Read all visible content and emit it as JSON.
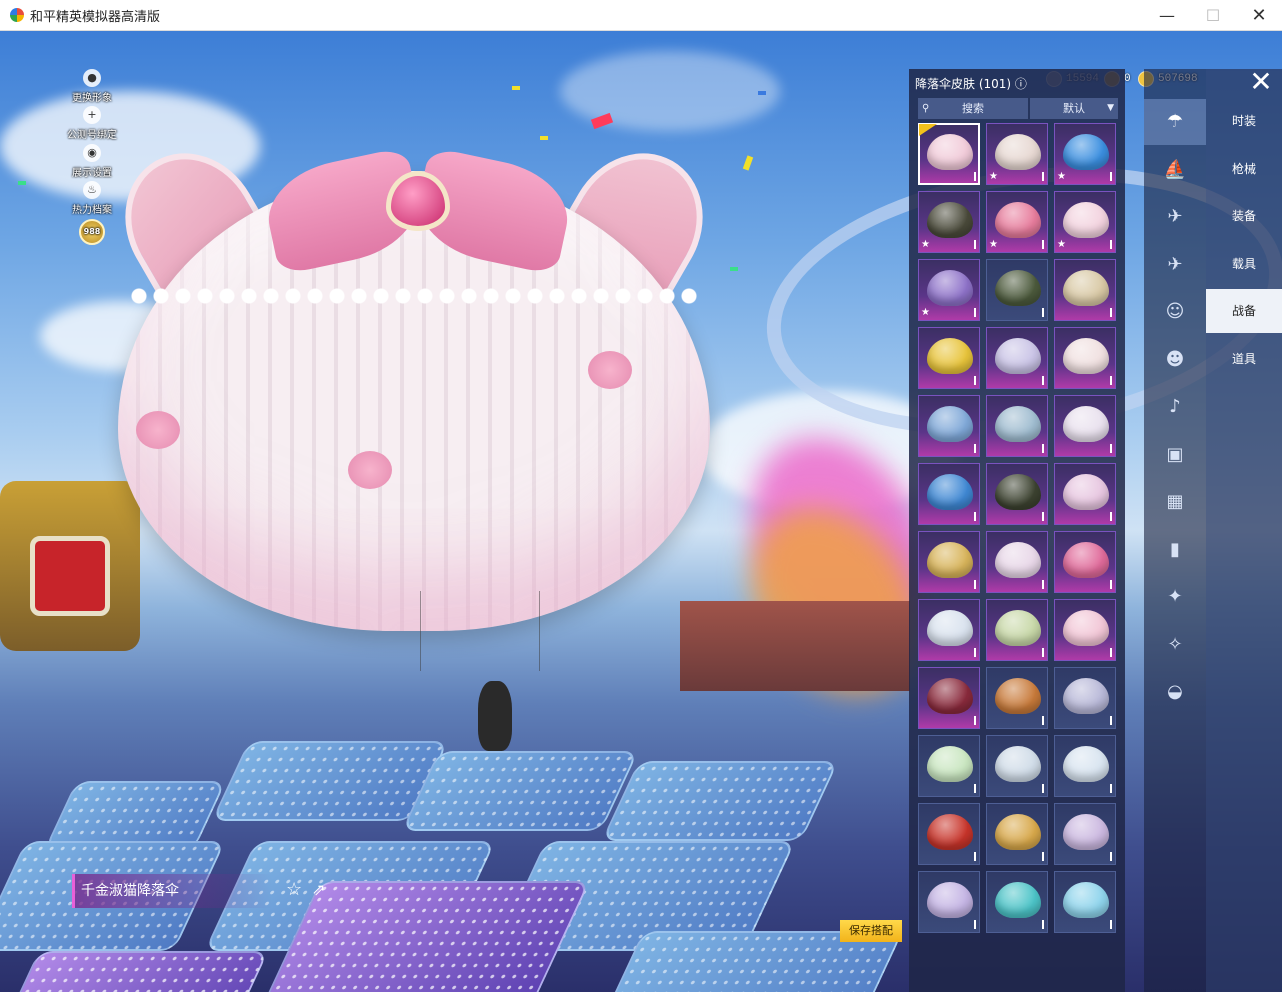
{
  "window": {
    "title": "和平精英模拟器高清版",
    "min_label": "—",
    "max_label": "☐",
    "close_label": "✕"
  },
  "left_menu": [
    {
      "label": "更换形象",
      "icon": "avatar-icon",
      "glyph": "●"
    },
    {
      "label": "公测号绑定",
      "icon": "plus-icon",
      "glyph": "+"
    },
    {
      "label": "展示设置",
      "icon": "eye-icon",
      "glyph": "◉"
    },
    {
      "label": "热力档案",
      "icon": "flame-icon",
      "glyph": "♨"
    },
    {
      "label": "988",
      "icon": "level-badge-icon",
      "glyph": ""
    }
  ],
  "currency": [
    {
      "value": "15594",
      "icon": "silver-coin-icon",
      "color": "#9aa6c0"
    },
    {
      "value": "0",
      "icon": "coupon-icon",
      "color": "#d9a72e"
    },
    {
      "value": "507698",
      "icon": "gold-coin-icon",
      "color": "#f0c541"
    }
  ],
  "panel": {
    "title": "降落伞皮肤 (101) ⓘ",
    "search_label": "搜索",
    "sort_label": "默认"
  },
  "grid_items": [
    {
      "color": "#f1cbd9",
      "star": false,
      "selected": true,
      "style": "purple"
    },
    {
      "color": "#e7d8d2",
      "star": true,
      "selected": false,
      "style": "purple"
    },
    {
      "color": "#3b8fe0",
      "star": true,
      "selected": false,
      "style": "purple"
    },
    {
      "color": "#4a4a3a",
      "star": true,
      "selected": false,
      "style": "purple"
    },
    {
      "color": "#e77c9c",
      "star": true,
      "selected": false,
      "style": "purple"
    },
    {
      "color": "#f3d3df",
      "star": true,
      "selected": false,
      "style": "purple"
    },
    {
      "color": "#8e72c9",
      "star": true,
      "selected": false,
      "style": "purple"
    },
    {
      "color": "#4c5a3c",
      "star": false,
      "selected": false,
      "style": "plain"
    },
    {
      "color": "#d9c9a5",
      "star": false,
      "selected": false,
      "style": "purple"
    },
    {
      "color": "#e8c43a",
      "star": false,
      "selected": false,
      "style": "purple"
    },
    {
      "color": "#c9c3e6",
      "star": false,
      "selected": false,
      "style": "purple"
    },
    {
      "color": "#f0e0e0",
      "star": false,
      "selected": false,
      "style": "purple"
    },
    {
      "color": "#7fa8d8",
      "star": false,
      "selected": false,
      "style": "purple"
    },
    {
      "color": "#9fbcd0",
      "star": false,
      "selected": false,
      "style": "purple"
    },
    {
      "color": "#e9e1ee",
      "star": false,
      "selected": false,
      "style": "purple"
    },
    {
      "color": "#3f88d4",
      "star": false,
      "selected": false,
      "style": "purple"
    },
    {
      "color": "#3c4230",
      "star": false,
      "selected": false,
      "style": "purple"
    },
    {
      "color": "#e7c6e0",
      "star": false,
      "selected": false,
      "style": "purple"
    },
    {
      "color": "#d8b45a",
      "star": false,
      "selected": false,
      "style": "purple"
    },
    {
      "color": "#e8d7e8",
      "star": false,
      "selected": false,
      "style": "purple"
    },
    {
      "color": "#e06a9a",
      "star": false,
      "selected": false,
      "style": "purple"
    },
    {
      "color": "#d9e2ee",
      "star": false,
      "selected": false,
      "style": "purple"
    },
    {
      "color": "#c8d8a8",
      "star": false,
      "selected": false,
      "style": "purple"
    },
    {
      "color": "#f2c6d6",
      "star": false,
      "selected": false,
      "style": "purple"
    },
    {
      "color": "#8a2a3c",
      "star": false,
      "selected": false,
      "style": "purple"
    },
    {
      "color": "#c87a3a",
      "star": false,
      "selected": false,
      "style": "plain"
    },
    {
      "color": "#b8b8d8",
      "star": false,
      "selected": false,
      "style": "plain"
    },
    {
      "color": "#c9e6c0",
      "star": false,
      "selected": false,
      "style": "plain"
    },
    {
      "color": "#d0dce8",
      "star": false,
      "selected": false,
      "style": "plain"
    },
    {
      "color": "#d8e4f0",
      "star": false,
      "selected": false,
      "style": "plain"
    },
    {
      "color": "#c8342a",
      "star": false,
      "selected": false,
      "style": "plain"
    },
    {
      "color": "#d8a84a",
      "star": false,
      "selected": false,
      "style": "plain"
    },
    {
      "color": "#cbb8e0",
      "star": false,
      "selected": false,
      "style": "plain"
    },
    {
      "color": "#c4b4e4",
      "star": false,
      "selected": false,
      "style": "plain"
    },
    {
      "color": "#4cc4c8",
      "star": false,
      "selected": false,
      "style": "plain"
    },
    {
      "color": "#8ed4ec",
      "star": false,
      "selected": false,
      "style": "plain"
    }
  ],
  "tab_icons": [
    {
      "icon": "parachute-icon",
      "glyph": "☂",
      "active": true
    },
    {
      "icon": "boat-icon",
      "glyph": "⛵",
      "active": false
    },
    {
      "icon": "drone-icon",
      "glyph": "✈",
      "active": false
    },
    {
      "icon": "plane-icon",
      "glyph": "✈",
      "active": false
    },
    {
      "icon": "emote-icon",
      "glyph": "☺",
      "active": false
    },
    {
      "icon": "robot-icon",
      "glyph": "☻",
      "active": false
    },
    {
      "icon": "speaker-icon",
      "glyph": "♪",
      "active": false
    },
    {
      "icon": "chat-bubble-icon",
      "glyph": "▣",
      "active": false
    },
    {
      "icon": "photo-icon",
      "glyph": "▦",
      "active": false
    },
    {
      "icon": "extinguisher-icon",
      "glyph": "▮",
      "active": false
    },
    {
      "icon": "sparkle-icon",
      "glyph": "✦",
      "active": false
    },
    {
      "icon": "magic-wand-icon",
      "glyph": "✧",
      "active": false
    },
    {
      "icon": "ufo-icon",
      "glyph": "◒",
      "active": false
    }
  ],
  "categories": [
    {
      "label": "时装",
      "active": false
    },
    {
      "label": "枪械",
      "active": false
    },
    {
      "label": "装备",
      "active": false
    },
    {
      "label": "载具",
      "active": false
    },
    {
      "label": "战备",
      "active": true
    },
    {
      "label": "道具",
      "active": false
    }
  ],
  "bottom": {
    "item_name": "千金淑猫降落伞",
    "fav_glyph": "☆",
    "share_glyph": "⇗",
    "save_label": "保存搭配"
  },
  "close_glyph": "✕",
  "check_mark": "✓",
  "star_glyph": "★"
}
